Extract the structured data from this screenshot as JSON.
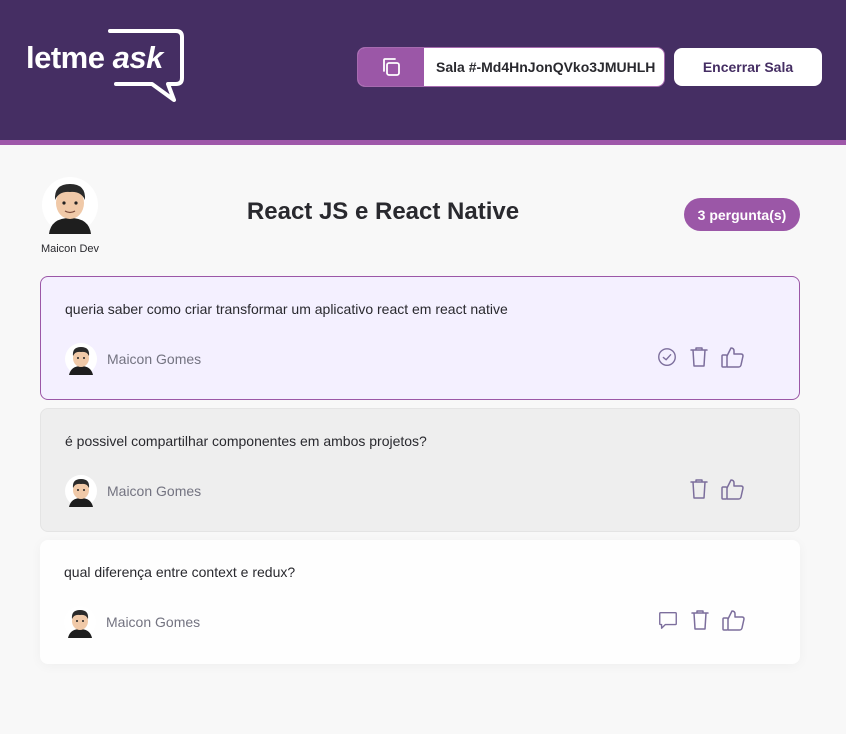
{
  "header": {
    "logo_text_main": "letme",
    "logo_text_accent": "ask",
    "room_code": "Sala #-Md4HnJonQVko3JMUHLH",
    "end_room_label": "Encerrar Sala"
  },
  "room": {
    "owner_name": "Maicon Dev",
    "title": "React JS e React Native",
    "question_count_label": "3 pergunta(s)"
  },
  "questions": [
    {
      "content": "queria saber como criar transformar um aplicativo react em react native",
      "author": "Maicon Gomes",
      "state": "highlighted",
      "icons": [
        "check-circle-icon",
        "trash-icon",
        "thumbs-up-icon"
      ]
    },
    {
      "content": "é possivel compartilhar componentes em ambos projetos?",
      "author": "Maicon Gomes",
      "state": "answered",
      "icons": [
        "trash-icon",
        "thumbs-up-icon"
      ]
    },
    {
      "content": "qual diferença entre context e redux?",
      "author": "Maicon Gomes",
      "state": "normal",
      "icons": [
        "answer-bubble-icon",
        "trash-icon",
        "thumbs-up-icon"
      ]
    }
  ],
  "colors": {
    "header_bg": "#452e63",
    "accent": "#9b57a7",
    "highlight_bg": "#f4f0ff",
    "answered_bg": "#eeeeee",
    "icon": "#7c6e9c"
  }
}
